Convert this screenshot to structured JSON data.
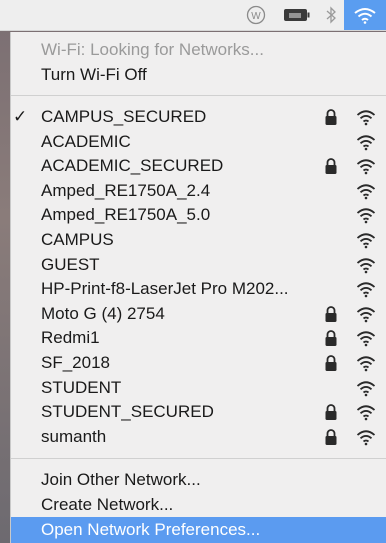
{
  "colors": {
    "menubar_bg": "#eeeeee",
    "menu_bg": "#f0efef",
    "highlight": "#5b9bf0"
  },
  "menubar": {
    "icons": [
      "circle-w-icon",
      "battery-icon",
      "bluetooth-icon",
      "wifi-icon"
    ]
  },
  "header": {
    "status": "Wi-Fi: Looking for Networks...",
    "toggle": "Turn Wi-Fi Off"
  },
  "networks": [
    {
      "name": "CAMPUS_SECURED",
      "checked": true,
      "locked": true
    },
    {
      "name": "ACADEMIC",
      "checked": false,
      "locked": false
    },
    {
      "name": "ACADEMIC_SECURED",
      "checked": false,
      "locked": true
    },
    {
      "name": "Amped_RE1750A_2.4",
      "checked": false,
      "locked": false
    },
    {
      "name": "Amped_RE1750A_5.0",
      "checked": false,
      "locked": false
    },
    {
      "name": "CAMPUS",
      "checked": false,
      "locked": false
    },
    {
      "name": "GUEST",
      "checked": false,
      "locked": false
    },
    {
      "name": "HP-Print-f8-LaserJet Pro M202...",
      "checked": false,
      "locked": false
    },
    {
      "name": "Moto G (4) 2754",
      "checked": false,
      "locked": true
    },
    {
      "name": "Redmi1",
      "checked": false,
      "locked": true
    },
    {
      "name": "SF_2018",
      "checked": false,
      "locked": true
    },
    {
      "name": "STUDENT",
      "checked": false,
      "locked": false
    },
    {
      "name": "STUDENT_SECURED",
      "checked": false,
      "locked": true
    },
    {
      "name": "sumanth",
      "checked": false,
      "locked": true
    }
  ],
  "check_mark": "✓",
  "footer": {
    "join": "Join Other Network...",
    "create": "Create Network...",
    "preferences": "Open Network Preferences..."
  }
}
